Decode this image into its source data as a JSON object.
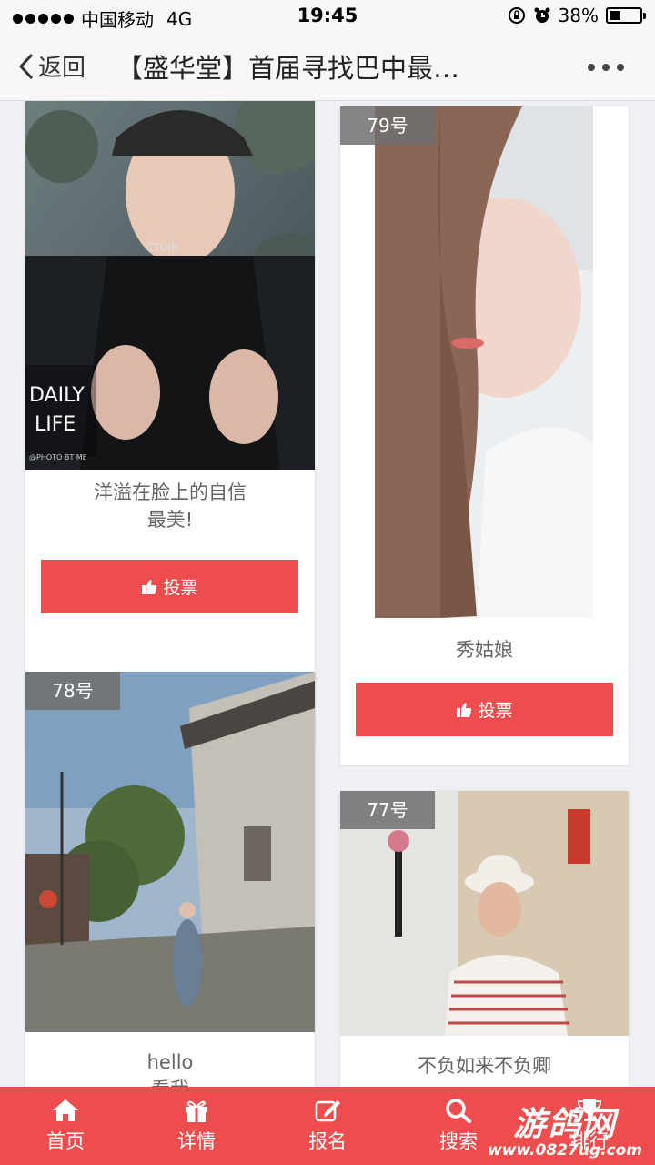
{
  "status_bar": {
    "carrier": "中国移动",
    "network": "4G",
    "time": "19:45",
    "battery": "38%",
    "battery_level": 0.38
  },
  "nav": {
    "back_label": "返回",
    "title": "【盛华堂】首届寻找巴中最…"
  },
  "cards": [
    {
      "number": "",
      "caption": "洋溢在脸上的自信\n最美!",
      "vote_label": "投票",
      "photo_text": {
        "daily": "DAILY",
        "life": "LIFE",
        "credit": "@PHOTO BT ME"
      }
    },
    {
      "number": "79号",
      "caption": "秀姑娘",
      "vote_label": "投票"
    },
    {
      "number": "78号",
      "caption": "hello\n看我"
    },
    {
      "number": "77号",
      "caption": "不负如来不负卿"
    }
  ],
  "tabs": [
    {
      "label": "首页",
      "icon": "home-icon"
    },
    {
      "label": "详情",
      "icon": "gift-icon"
    },
    {
      "label": "报名",
      "icon": "edit-icon"
    },
    {
      "label": "搜索",
      "icon": "search-icon"
    },
    {
      "label": "排行",
      "icon": "trophy-icon"
    }
  ],
  "watermark": {
    "line1": "游鸽网",
    "line2": "www.0827ug.com"
  },
  "colors": {
    "accent": "#ee4d4d",
    "background": "#eef0f4"
  }
}
